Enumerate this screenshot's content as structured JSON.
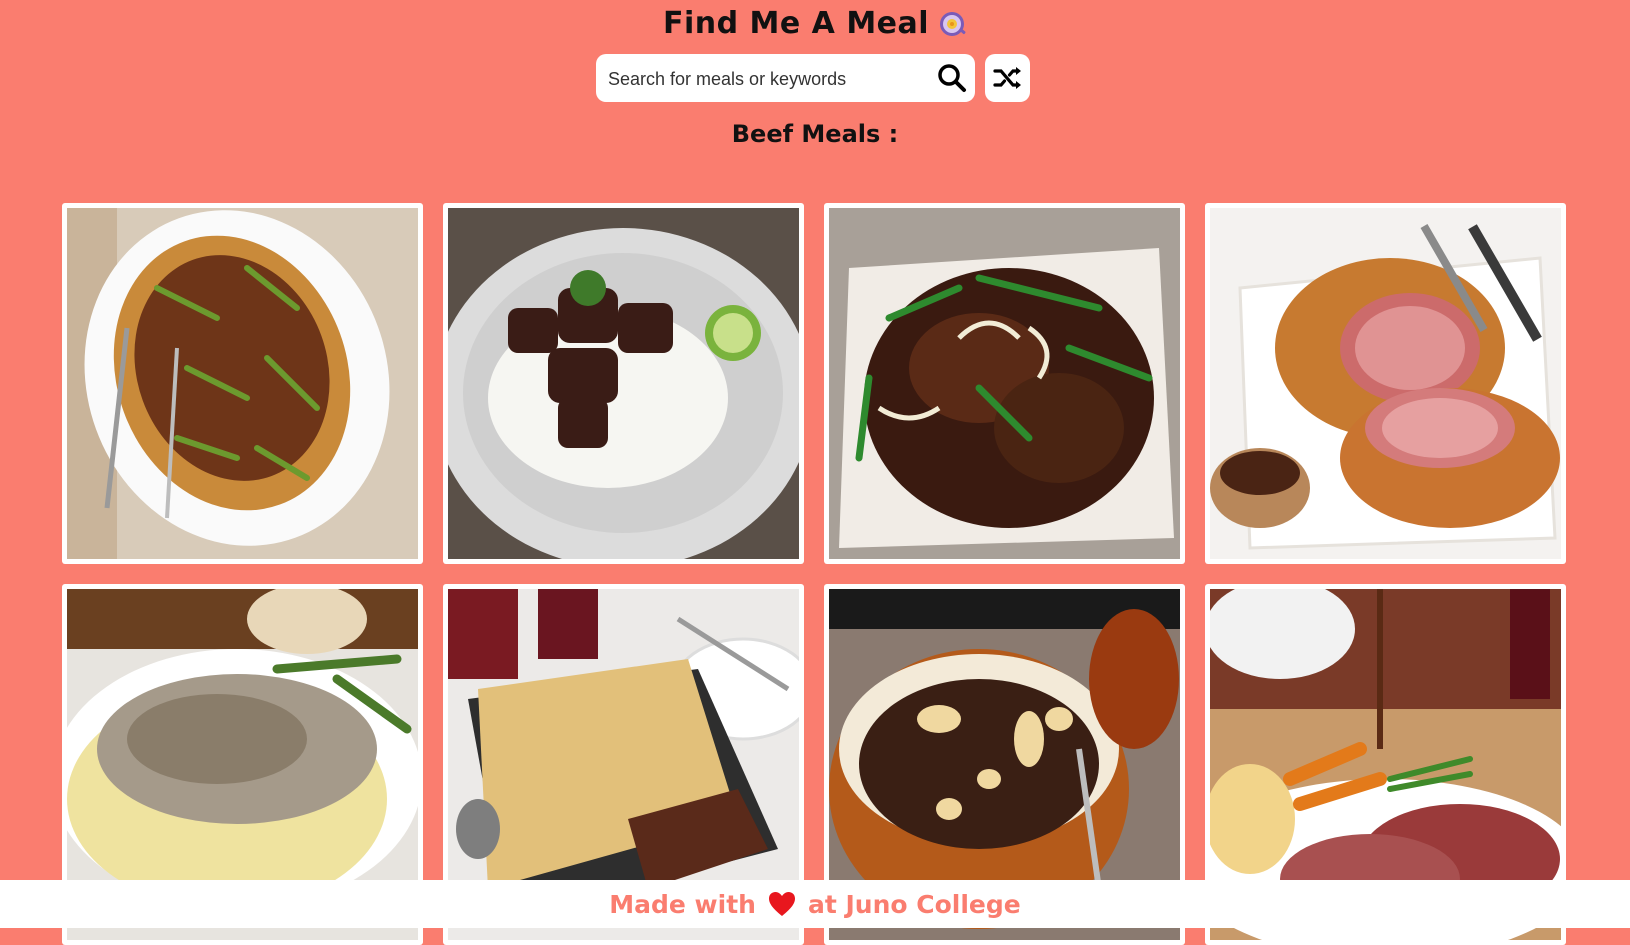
{
  "header": {
    "title": "Find Me A Meal",
    "logo_icon": "cooking-pan-icon"
  },
  "search": {
    "placeholder": "Search for meals or keywords",
    "value": "",
    "search_icon": "search-icon",
    "random_icon": "shuffle-icon"
  },
  "section": {
    "title": "Beef Meals :"
  },
  "meals": [
    {
      "image": "beef-asparagus-stir-fry-photo"
    },
    {
      "image": "beef-stew-rice-lime-photo"
    },
    {
      "image": "beef-onion-stir-fry-photo"
    },
    {
      "image": "beef-wellington-photo"
    },
    {
      "image": "beef-stroganoff-noodles-photo"
    },
    {
      "image": "beef-pie-photo"
    },
    {
      "image": "beef-bourguignon-pot-photo"
    },
    {
      "image": "roast-beef-dinner-photo"
    }
  ],
  "footer": {
    "prefix": "Made with",
    "suffix": "at Juno College",
    "heart_icon": "heart-icon",
    "accent_color": "#fa7d6f"
  },
  "colors": {
    "background": "#fa7d6f",
    "card": "#ffffff",
    "heart": "#e8171e"
  }
}
